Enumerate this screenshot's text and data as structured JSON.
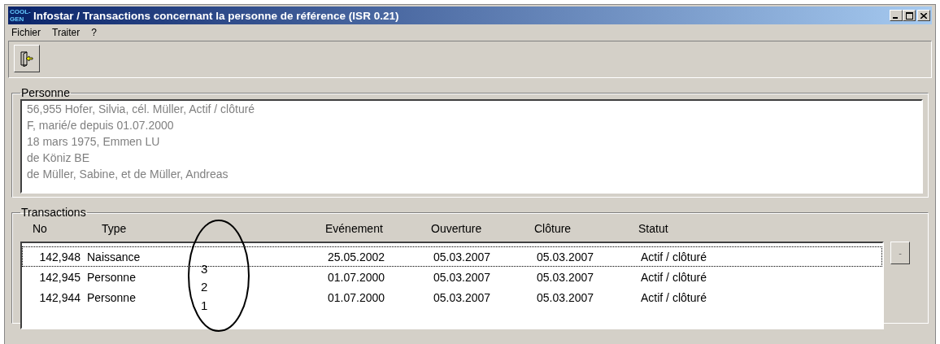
{
  "window": {
    "title": "Infostar / Transactions concernant la personne de référence (ISR 0.21)",
    "app_icon_text": [
      "COOL-",
      "GEN"
    ]
  },
  "menu": [
    {
      "label": "Fichier"
    },
    {
      "label": "Traiter"
    },
    {
      "label": "?"
    }
  ],
  "personne": {
    "title": "Personne",
    "lines": [
      "56,955  Hofer, Silvia, cél. Müller, Actif / clôturé",
      "F, marié/e depuis 01.07.2000",
      "18 mars 1975, Emmen LU",
      "de Köniz BE",
      "de Müller, Sabine, et de Müller, Andreas"
    ]
  },
  "transactions": {
    "title": "Transactions",
    "columns": [
      "No",
      "Type",
      "Evénement",
      "Ouverture",
      "Clôture",
      "Statut"
    ],
    "rows": [
      {
        "no": "142,948",
        "type": "Naissance",
        "evenement": "25.05.2002",
        "ouverture": "05.03.2007",
        "cloture": "05.03.2007",
        "statut": "Actif / clôturé",
        "selected": true
      },
      {
        "no": "142,945",
        "type": "Personne",
        "evenement": "01.07.2000",
        "ouverture": "05.03.2007",
        "cloture": "05.03.2007",
        "statut": "Actif / clôturé",
        "selected": false
      },
      {
        "no": "142,944",
        "type": "Personne",
        "evenement": "01.07.2000",
        "ouverture": "05.03.2007",
        "cloture": "05.03.2007",
        "statut": "Actif / clôturé",
        "selected": false
      }
    ],
    "side_button": "-"
  },
  "annotation": {
    "numbers": [
      "3",
      "2",
      "1"
    ]
  }
}
